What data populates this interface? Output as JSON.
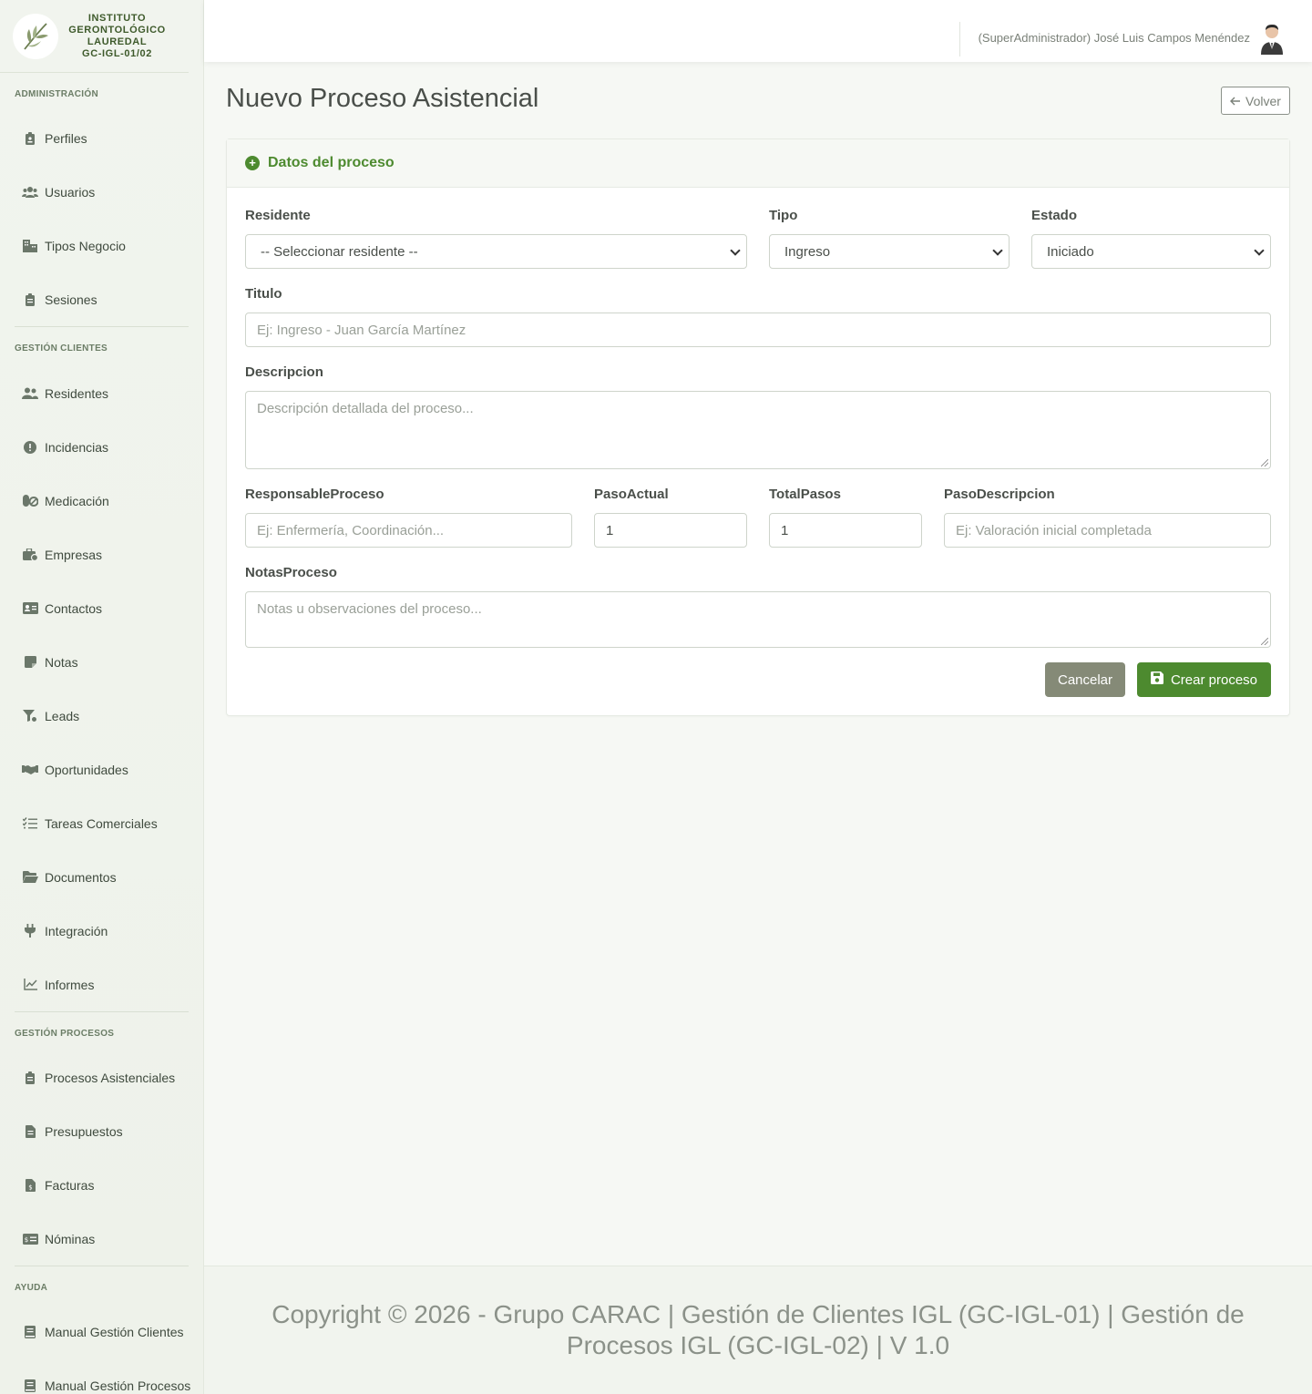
{
  "brand": {
    "line1": "INSTITUTO",
    "line2": "GERONTOLÓGICO",
    "line3": "LAUREDAL",
    "line4": "GC-IGL-01/02"
  },
  "sidebar": {
    "sections": [
      {
        "title": "ADMINISTRACIÓN",
        "items": [
          {
            "label": "Perfiles",
            "icon": "id-badge-icon"
          },
          {
            "label": "Usuarios",
            "icon": "users-icon"
          },
          {
            "label": "Tipos Negocio",
            "icon": "building-icon"
          },
          {
            "label": "Sesiones",
            "icon": "clipboard-icon"
          }
        ]
      },
      {
        "title": "GESTIÓN CLIENTES",
        "items": [
          {
            "label": "Residentes",
            "icon": "user-group-icon"
          },
          {
            "label": "Incidencias",
            "icon": "alert-icon"
          },
          {
            "label": "Medicación",
            "icon": "pills-icon"
          },
          {
            "label": "Empresas",
            "icon": "briefcase-icon"
          },
          {
            "label": "Contactos",
            "icon": "address-card-icon"
          },
          {
            "label": "Notas",
            "icon": "note-icon"
          },
          {
            "label": "Leads",
            "icon": "funnel-icon"
          },
          {
            "label": "Oportunidades",
            "icon": "handshake-icon"
          },
          {
            "label": "Tareas Comerciales",
            "icon": "list-check-icon"
          },
          {
            "label": "Documentos",
            "icon": "folder-icon"
          },
          {
            "label": "Integración",
            "icon": "plug-icon"
          },
          {
            "label": "Informes",
            "icon": "chart-line-icon"
          }
        ]
      },
      {
        "title": "GESTIÓN PROCESOS",
        "items": [
          {
            "label": "Procesos Asistenciales",
            "icon": "clipboard-list-icon"
          },
          {
            "label": "Presupuestos",
            "icon": "file-invoice-icon"
          },
          {
            "label": "Facturas",
            "icon": "file-dollar-icon"
          },
          {
            "label": "Nóminas",
            "icon": "money-check-icon"
          }
        ]
      },
      {
        "title": "AYUDA",
        "items": [
          {
            "label": "Manual Gestión Clientes",
            "icon": "book-icon"
          },
          {
            "label": "Manual Gestión Procesos",
            "icon": "book-icon"
          }
        ]
      }
    ]
  },
  "topbar": {
    "user": "(SuperAdministrador) José Luis Campos Menéndez"
  },
  "main": {
    "title": "Nuevo Proceso Asistencial",
    "back_label": "Volver",
    "card_title": "Datos del proceso",
    "form": {
      "residente_label": "Residente",
      "residente_value": "-- Seleccionar residente --",
      "tipo_label": "Tipo",
      "tipo_value": "Ingreso",
      "estado_label": "Estado",
      "estado_value": "Iniciado",
      "titulo_label": "Titulo",
      "titulo_placeholder": "Ej: Ingreso - Juan García Martínez",
      "descripcion_label": "Descripcion",
      "descripcion_placeholder": "Descripción detallada del proceso...",
      "responsable_label": "ResponsableProceso",
      "responsable_placeholder": "Ej: Enfermería, Coordinación...",
      "paso_actual_label": "PasoActual",
      "paso_actual_value": "1",
      "total_pasos_label": "TotalPasos",
      "total_pasos_value": "1",
      "paso_desc_label": "PasoDescripcion",
      "paso_desc_placeholder": "Ej: Valoración inicial completada",
      "notas_label": "NotasProceso",
      "notas_placeholder": "Notas u observaciones del proceso..."
    },
    "cancel_label": "Cancelar",
    "create_label": "Crear proceso"
  },
  "footer": {
    "text": "Copyright © 2026 - Grupo CARAC | Gestión de Clientes IGL (GC-IGL-01) | Gestión de Procesos IGL (GC-IGL-02) | V 1.0"
  },
  "colors": {
    "accent": "#4d8a2f",
    "cancel": "#858a77",
    "sidebar_bg": "#f1f4ee"
  }
}
